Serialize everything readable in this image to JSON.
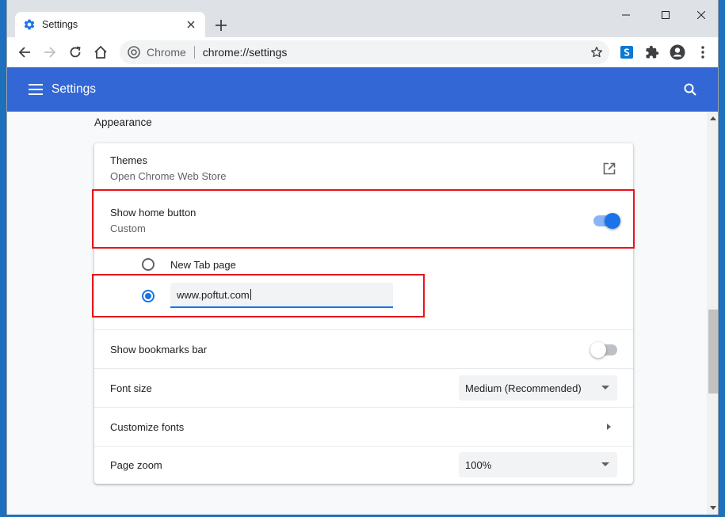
{
  "tab": {
    "title": "Settings",
    "favicon": "gear-icon"
  },
  "omnibox": {
    "chip": "Chrome",
    "url": "chrome://settings"
  },
  "header": {
    "title": "Settings"
  },
  "appearance": {
    "section_title": "Appearance",
    "themes": {
      "label": "Themes",
      "sublabel": "Open Chrome Web Store"
    },
    "home_button": {
      "label": "Show home button",
      "sublabel": "Custom",
      "enabled": true
    },
    "home_options": {
      "new_tab_label": "New Tab page",
      "custom_url": "www.poftut.com",
      "selected": "custom"
    },
    "bookmarks_bar": {
      "label": "Show bookmarks bar",
      "enabled": false
    },
    "font_size": {
      "label": "Font size",
      "value": "Medium (Recommended)"
    },
    "customize_fonts": {
      "label": "Customize fonts"
    },
    "page_zoom": {
      "label": "Page zoom",
      "value": "100%"
    }
  },
  "colors": {
    "accent": "#1a73e8",
    "header_bg": "#3367d6",
    "highlight": "#e8141b"
  }
}
